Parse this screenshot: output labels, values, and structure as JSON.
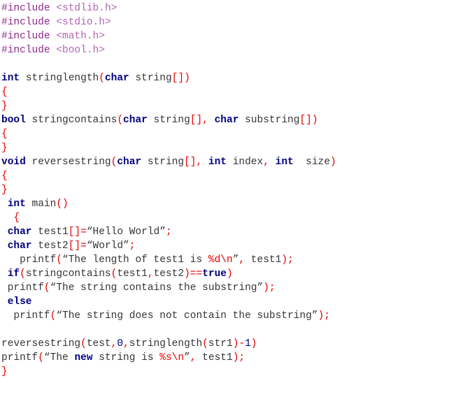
{
  "document": {
    "kind": "source-code-listing",
    "language": "C",
    "background_color": "#ffffff"
  },
  "theme": {
    "preprocessor_color": "#8e2a8e",
    "header_color": "#b267b2",
    "keyword_color": "#000080",
    "punctuation_color": "#e60000",
    "identifier_color": "#353535",
    "string_color": "#353535",
    "format_specifier_color": "#e60000",
    "number_color": "#000080"
  },
  "lines": [
    {
      "n": 1,
      "tokens": [
        {
          "t": "#include",
          "c": "pre"
        },
        {
          "t": " ",
          "c": "id"
        },
        {
          "t": "<stdlib.h>",
          "c": "hdr"
        }
      ]
    },
    {
      "n": 2,
      "tokens": [
        {
          "t": "#include",
          "c": "pre"
        },
        {
          "t": " ",
          "c": "id"
        },
        {
          "t": "<stdio.h>",
          "c": "hdr"
        }
      ]
    },
    {
      "n": 3,
      "tokens": [
        {
          "t": "#include",
          "c": "pre"
        },
        {
          "t": " ",
          "c": "id"
        },
        {
          "t": "<math.h>",
          "c": "hdr"
        }
      ]
    },
    {
      "n": 4,
      "tokens": [
        {
          "t": "#include",
          "c": "pre"
        },
        {
          "t": " ",
          "c": "id"
        },
        {
          "t": "<bool.h>",
          "c": "hdr"
        }
      ]
    },
    {
      "n": 5,
      "tokens": []
    },
    {
      "n": 6,
      "tokens": [
        {
          "t": "int",
          "c": "kw"
        },
        {
          "t": " stringlength",
          "c": "id"
        },
        {
          "t": "(",
          "c": "punc"
        },
        {
          "t": "char",
          "c": "kw"
        },
        {
          "t": " string",
          "c": "id"
        },
        {
          "t": "[])",
          "c": "punc"
        }
      ]
    },
    {
      "n": 7,
      "tokens": [
        {
          "t": "{",
          "c": "brace"
        }
      ]
    },
    {
      "n": 8,
      "tokens": [
        {
          "t": "}",
          "c": "brace"
        }
      ]
    },
    {
      "n": 9,
      "tokens": [
        {
          "t": "bool",
          "c": "kw"
        },
        {
          "t": " stringcontains",
          "c": "id"
        },
        {
          "t": "(",
          "c": "punc"
        },
        {
          "t": "char",
          "c": "kw"
        },
        {
          "t": " string",
          "c": "id"
        },
        {
          "t": "[],",
          "c": "punc"
        },
        {
          "t": " ",
          "c": "id"
        },
        {
          "t": "char",
          "c": "kw"
        },
        {
          "t": " substring",
          "c": "id"
        },
        {
          "t": "[])",
          "c": "punc"
        }
      ]
    },
    {
      "n": 10,
      "tokens": [
        {
          "t": "{",
          "c": "brace"
        }
      ]
    },
    {
      "n": 11,
      "tokens": [
        {
          "t": "}",
          "c": "brace"
        }
      ]
    },
    {
      "n": 12,
      "tokens": [
        {
          "t": "void",
          "c": "kw"
        },
        {
          "t": " reversestring",
          "c": "id"
        },
        {
          "t": "(",
          "c": "punc"
        },
        {
          "t": "char",
          "c": "kw"
        },
        {
          "t": " string",
          "c": "id"
        },
        {
          "t": "[],",
          "c": "punc"
        },
        {
          "t": " ",
          "c": "id"
        },
        {
          "t": "int",
          "c": "kw"
        },
        {
          "t": " index",
          "c": "id"
        },
        {
          "t": ",",
          "c": "punc"
        },
        {
          "t": " ",
          "c": "id"
        },
        {
          "t": "int",
          "c": "kw"
        },
        {
          "t": "  size",
          "c": "id"
        },
        {
          "t": ")",
          "c": "punc"
        }
      ]
    },
    {
      "n": 13,
      "tokens": [
        {
          "t": "{",
          "c": "brace"
        }
      ]
    },
    {
      "n": 14,
      "tokens": [
        {
          "t": "}",
          "c": "brace"
        }
      ]
    },
    {
      "n": 15,
      "tokens": [
        {
          "t": " ",
          "c": "id"
        },
        {
          "t": "int",
          "c": "kw"
        },
        {
          "t": " main",
          "c": "id"
        },
        {
          "t": "()",
          "c": "punc"
        }
      ]
    },
    {
      "n": 16,
      "tokens": [
        {
          "t": "  ",
          "c": "id"
        },
        {
          "t": "{",
          "c": "brace"
        }
      ]
    },
    {
      "n": 17,
      "tokens": [
        {
          "t": " ",
          "c": "id"
        },
        {
          "t": "char",
          "c": "kw"
        },
        {
          "t": " test1",
          "c": "id"
        },
        {
          "t": "[]=",
          "c": "punc"
        },
        {
          "t": "“Hello World”",
          "c": "str"
        },
        {
          "t": ";",
          "c": "punc"
        }
      ]
    },
    {
      "n": 18,
      "tokens": [
        {
          "t": " ",
          "c": "id"
        },
        {
          "t": "char",
          "c": "kw"
        },
        {
          "t": " test2",
          "c": "id"
        },
        {
          "t": "[]=",
          "c": "punc"
        },
        {
          "t": "“World”",
          "c": "str"
        },
        {
          "t": ";",
          "c": "punc"
        }
      ]
    },
    {
      "n": 19,
      "tokens": [
        {
          "t": "   printf",
          "c": "id"
        },
        {
          "t": "(",
          "c": "punc"
        },
        {
          "t": "“The length of test1 is ",
          "c": "str"
        },
        {
          "t": "%d\\n",
          "c": "fmt"
        },
        {
          "t": "”",
          "c": "str"
        },
        {
          "t": ",",
          "c": "punc"
        },
        {
          "t": " test1",
          "c": "id"
        },
        {
          "t": ");",
          "c": "punc"
        }
      ]
    },
    {
      "n": 20,
      "tokens": [
        {
          "t": " ",
          "c": "id"
        },
        {
          "t": "if",
          "c": "kw"
        },
        {
          "t": "(",
          "c": "punc"
        },
        {
          "t": "stringcontains",
          "c": "id"
        },
        {
          "t": "(",
          "c": "punc"
        },
        {
          "t": "test1",
          "c": "id"
        },
        {
          "t": ",",
          "c": "punc"
        },
        {
          "t": "test2",
          "c": "id"
        },
        {
          "t": ")==",
          "c": "punc"
        },
        {
          "t": "true",
          "c": "kw"
        },
        {
          "t": ")",
          "c": "punc"
        }
      ]
    },
    {
      "n": 21,
      "tokens": [
        {
          "t": " printf",
          "c": "id"
        },
        {
          "t": "(",
          "c": "punc"
        },
        {
          "t": "“The string contains the substring”",
          "c": "str"
        },
        {
          "t": ");",
          "c": "punc"
        }
      ]
    },
    {
      "n": 22,
      "tokens": [
        {
          "t": " ",
          "c": "id"
        },
        {
          "t": "else",
          "c": "kw"
        }
      ]
    },
    {
      "n": 23,
      "tokens": [
        {
          "t": "  printf",
          "c": "id"
        },
        {
          "t": "(",
          "c": "punc"
        },
        {
          "t": "“The string does not contain the substring”",
          "c": "str"
        },
        {
          "t": ");",
          "c": "punc"
        }
      ]
    },
    {
      "n": 24,
      "tokens": []
    },
    {
      "n": 25,
      "tokens": [
        {
          "t": "reversestring",
          "c": "id"
        },
        {
          "t": "(",
          "c": "punc"
        },
        {
          "t": "test",
          "c": "id"
        },
        {
          "t": ",",
          "c": "punc"
        },
        {
          "t": "0",
          "c": "num"
        },
        {
          "t": ",",
          "c": "punc"
        },
        {
          "t": "stringlength",
          "c": "id"
        },
        {
          "t": "(",
          "c": "punc"
        },
        {
          "t": "str1",
          "c": "id"
        },
        {
          "t": ")-",
          "c": "punc"
        },
        {
          "t": "1",
          "c": "num"
        },
        {
          "t": ")",
          "c": "punc"
        }
      ]
    },
    {
      "n": 26,
      "tokens": [
        {
          "t": "printf",
          "c": "id"
        },
        {
          "t": "(",
          "c": "punc"
        },
        {
          "t": "“The ",
          "c": "str"
        },
        {
          "t": "new",
          "c": "kw"
        },
        {
          "t": " string is ",
          "c": "str"
        },
        {
          "t": "%s\\n",
          "c": "fmt"
        },
        {
          "t": "”",
          "c": "str"
        },
        {
          "t": ",",
          "c": "punc"
        },
        {
          "t": " test1",
          "c": "id"
        },
        {
          "t": ");",
          "c": "punc"
        }
      ]
    },
    {
      "n": 27,
      "tokens": [
        {
          "t": "}",
          "c": "brace"
        }
      ]
    }
  ],
  "plain_text": "#include <stdlib.h>\n#include <stdio.h>\n#include <math.h>\n#include <bool.h>\n\nint stringlength(char string[])\n{\n}\nbool stringcontains(char string[], char substring[])\n{\n}\nvoid reversestring(char string[], int index, int  size)\n{\n}\n int main()\n  {\n char test1[]=“Hello World”;\n char test2[]=“World”;\n   printf(“The length of test1 is %d\\n”, test1);\n if(stringcontains(test1,test2)==true)\n printf(“The string contains the substring”);\n else\n  printf(“The string does not contain the substring”);\n\nreversestring(test,0,stringlength(str1)-1)\nprintf(“The new string is %s\\n”, test1);\n}"
}
